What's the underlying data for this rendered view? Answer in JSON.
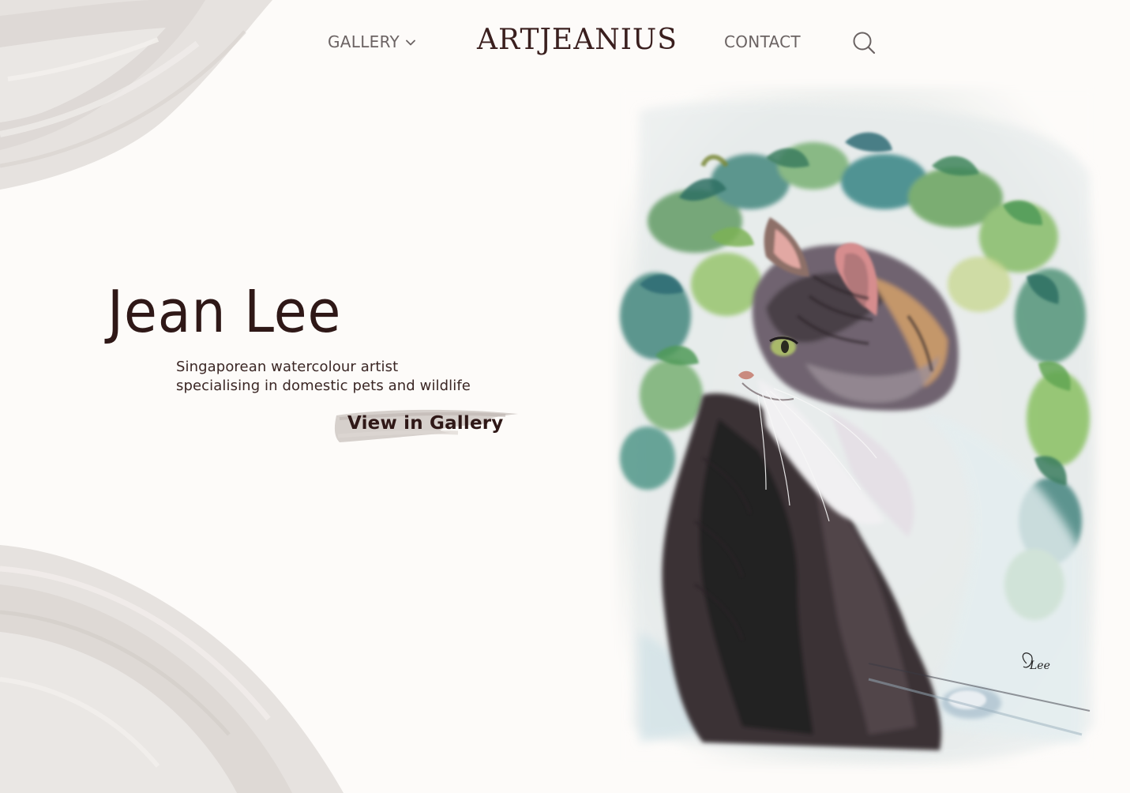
{
  "nav": {
    "gallery_label": "GALLERY",
    "brand": "ARTJEANIUS",
    "contact_label": "CONTACT"
  },
  "hero": {
    "title": "Jean Lee",
    "subtitle_lines": [
      "Singaporean watercolour artist",
      "specialising in domestic pets and wildlife"
    ],
    "cta_label": "View in Gallery"
  },
  "painting": {
    "signature": "Lee"
  },
  "colors": {
    "background": "#fdfbf9",
    "text_dark": "#2f1817",
    "nav_text": "#6b6363",
    "brush": "#d9d4d0"
  },
  "icons": {
    "dropdown": "chevron-down-icon",
    "search": "search-icon"
  }
}
